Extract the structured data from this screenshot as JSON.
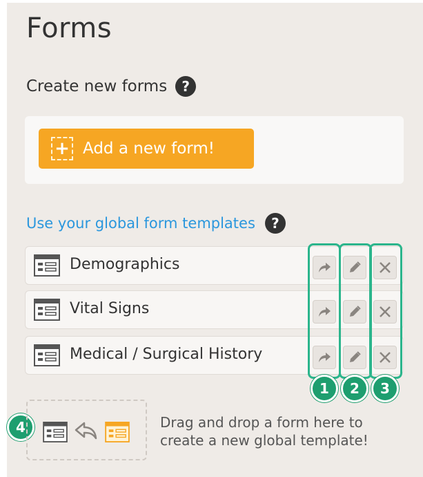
{
  "page": {
    "title": "Forms"
  },
  "create": {
    "heading": "Create new forms",
    "help": "?",
    "add_button": "Add a new form!",
    "add_plus": "+"
  },
  "templates": {
    "heading": "Use your global form templates",
    "help": "?",
    "items": [
      {
        "name": "Demographics"
      },
      {
        "name": "Vital Signs"
      },
      {
        "name": "Medical / Surgical History"
      }
    ],
    "actions": [
      "share-icon",
      "pencil-icon",
      "close-icon"
    ]
  },
  "callouts": [
    "1",
    "2",
    "3",
    "4"
  ],
  "drop_zone": {
    "line1": "Drag and drop a form here to",
    "line2": "create a new global template!"
  },
  "colors": {
    "accent": "#f6a623",
    "link": "#2b97dd",
    "callout": "#1e9e6f",
    "outline": "#2bb58c",
    "panel": "#efebe7"
  }
}
